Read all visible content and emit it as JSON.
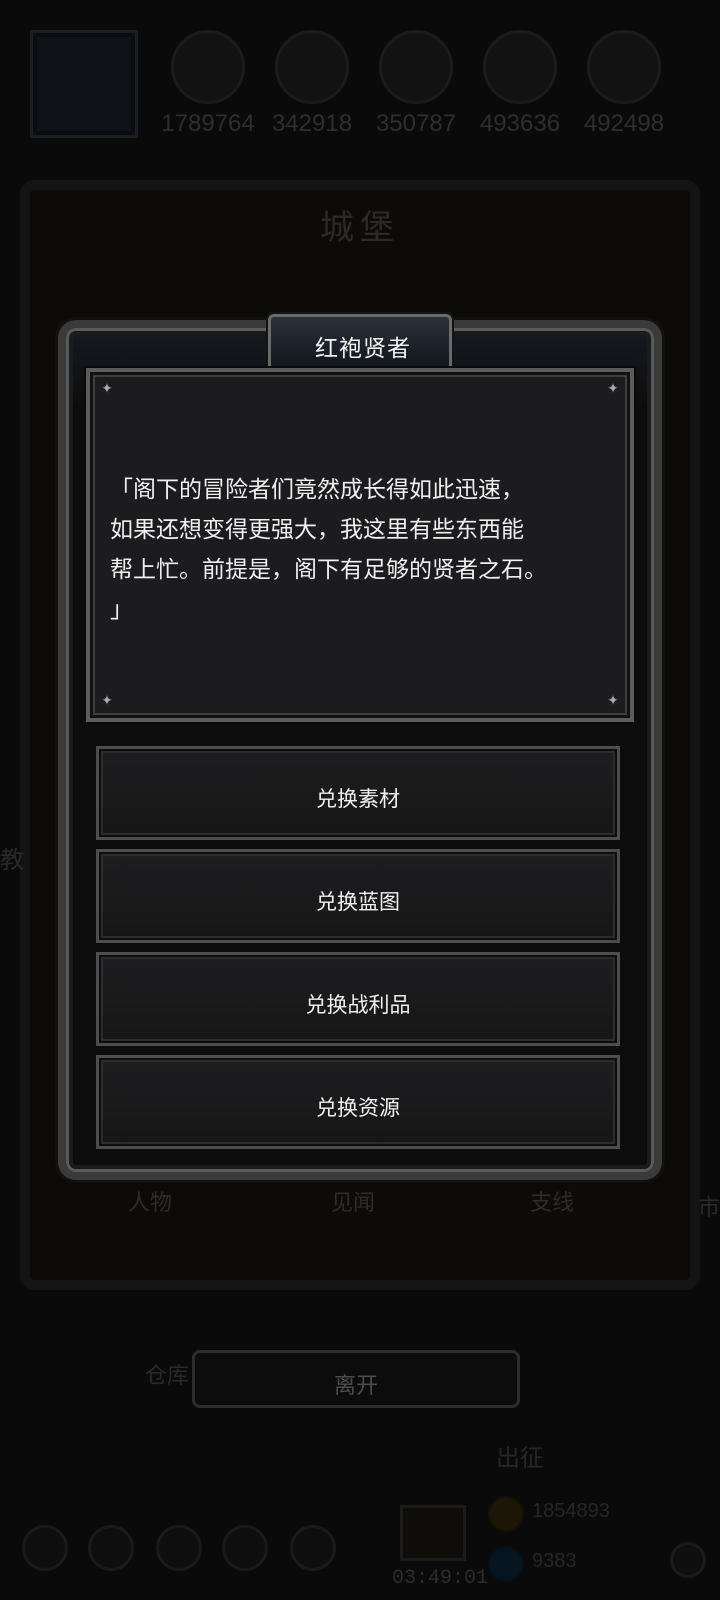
{
  "resources": {
    "values": [
      "1789764",
      "342918",
      "350787",
      "493636",
      "492498"
    ]
  },
  "castle": {
    "title": "城堡",
    "tabs": [
      "人物",
      "见闻",
      "支线"
    ],
    "side_left": "教",
    "side_right": "市",
    "warehouse": "仓库",
    "expedition": "出征"
  },
  "dialog": {
    "title": "红袍贤者",
    "speech": "「阁下的冒险者们竟然成长得如此迅速，\n如果还想变得更强大，我这里有些东西能\n帮上忙。前提是，阁下有足够的贤者之石。\n」",
    "options": [
      "兑换素材",
      "兑换蓝图",
      "兑换战利品",
      "兑换资源"
    ]
  },
  "leave_label": "离开",
  "footer": {
    "timer": "03:49:01",
    "gold": "1854893",
    "gems": "9383"
  }
}
